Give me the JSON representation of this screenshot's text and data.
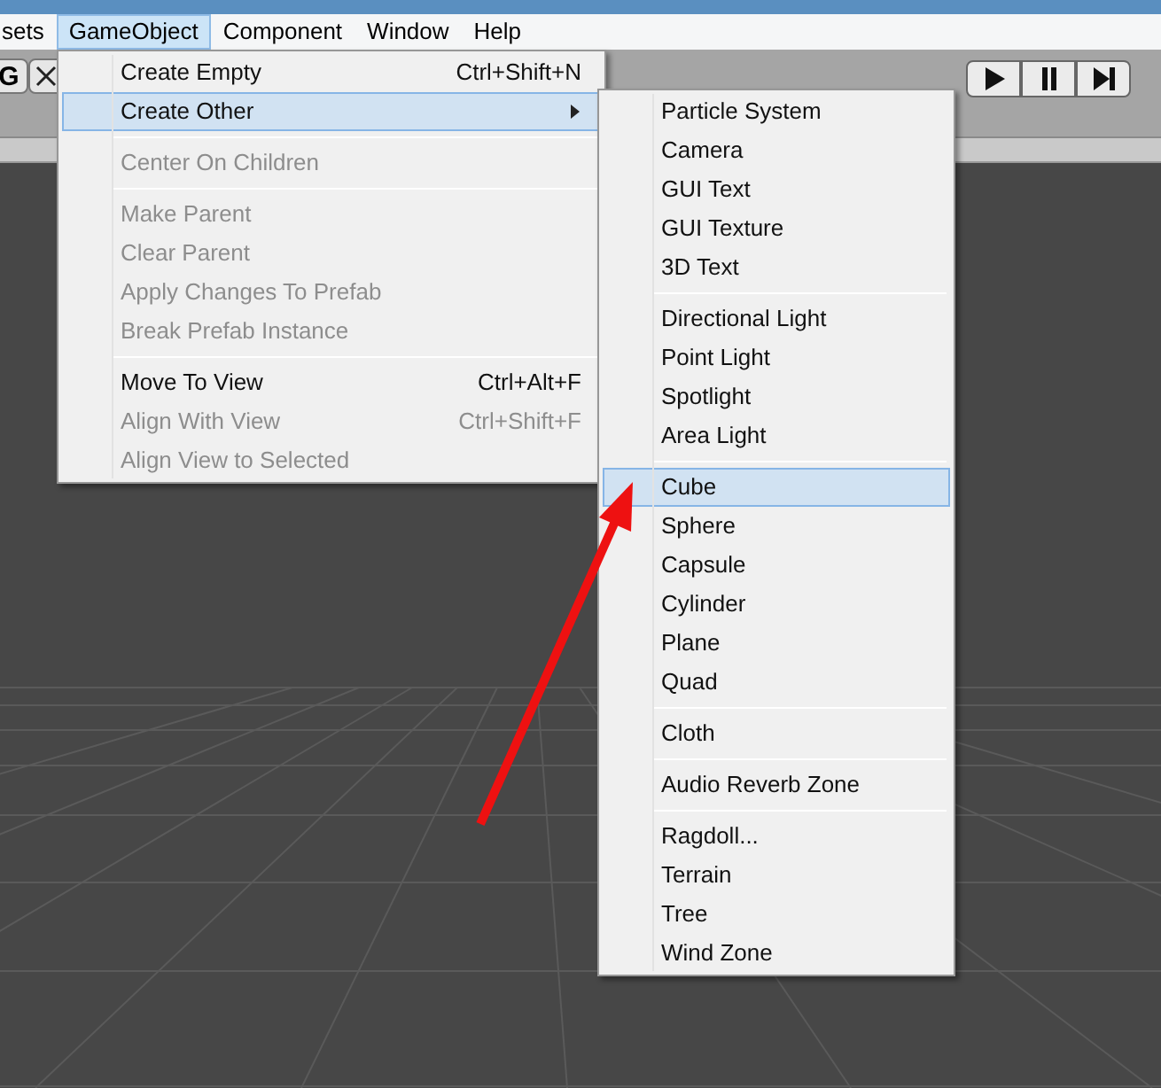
{
  "menu_bar": [
    {
      "label": "sets",
      "selected": false
    },
    {
      "label": "GameObject",
      "selected": true
    },
    {
      "label": "Component",
      "selected": false
    },
    {
      "label": "Window",
      "selected": false
    },
    {
      "label": "Help",
      "selected": false
    }
  ],
  "toolbar": {
    "tool_label": "G"
  },
  "menu": [
    {
      "kind": "item",
      "label": "Create Empty",
      "shortcut": "Ctrl+Shift+N",
      "disabled": false,
      "selected": false,
      "submenu": false
    },
    {
      "kind": "item",
      "label": "Create Other",
      "disabled": false,
      "selected": true,
      "submenu": true
    },
    {
      "kind": "separator"
    },
    {
      "kind": "item",
      "label": "Center On Children",
      "disabled": true,
      "selected": false,
      "submenu": false
    },
    {
      "kind": "separator"
    },
    {
      "kind": "item",
      "label": "Make Parent",
      "disabled": true,
      "selected": false,
      "submenu": false
    },
    {
      "kind": "item",
      "label": "Clear Parent",
      "disabled": true,
      "selected": false,
      "submenu": false
    },
    {
      "kind": "item",
      "label": "Apply Changes To Prefab",
      "disabled": true,
      "selected": false,
      "submenu": false
    },
    {
      "kind": "item",
      "label": "Break Prefab Instance",
      "disabled": true,
      "selected": false,
      "submenu": false
    },
    {
      "kind": "separator"
    },
    {
      "kind": "item",
      "label": "Move To View",
      "shortcut": "Ctrl+Alt+F",
      "disabled": false,
      "selected": false,
      "submenu": false
    },
    {
      "kind": "item",
      "label": "Align With View",
      "shortcut": "Ctrl+Shift+F",
      "disabled": true,
      "selected": false,
      "submenu": false
    },
    {
      "kind": "item",
      "label": "Align View to Selected",
      "disabled": true,
      "selected": false,
      "submenu": false
    }
  ],
  "submenu": [
    {
      "kind": "item",
      "label": "Particle System",
      "selected": false
    },
    {
      "kind": "item",
      "label": "Camera",
      "selected": false
    },
    {
      "kind": "item",
      "label": "GUI Text",
      "selected": false
    },
    {
      "kind": "item",
      "label": "GUI Texture",
      "selected": false
    },
    {
      "kind": "item",
      "label": "3D Text",
      "selected": false
    },
    {
      "kind": "separator"
    },
    {
      "kind": "item",
      "label": "Directional Light",
      "selected": false
    },
    {
      "kind": "item",
      "label": "Point Light",
      "selected": false
    },
    {
      "kind": "item",
      "label": "Spotlight",
      "selected": false
    },
    {
      "kind": "item",
      "label": "Area Light",
      "selected": false
    },
    {
      "kind": "separator"
    },
    {
      "kind": "item",
      "label": "Cube",
      "selected": true
    },
    {
      "kind": "item",
      "label": "Sphere",
      "selected": false
    },
    {
      "kind": "item",
      "label": "Capsule",
      "selected": false
    },
    {
      "kind": "item",
      "label": "Cylinder",
      "selected": false
    },
    {
      "kind": "item",
      "label": "Plane",
      "selected": false
    },
    {
      "kind": "item",
      "label": "Quad",
      "selected": false
    },
    {
      "kind": "separator"
    },
    {
      "kind": "item",
      "label": "Cloth",
      "selected": false
    },
    {
      "kind": "separator"
    },
    {
      "kind": "item",
      "label": "Audio Reverb Zone",
      "selected": false
    },
    {
      "kind": "separator"
    },
    {
      "kind": "item",
      "label": "Ragdoll...",
      "selected": false
    },
    {
      "kind": "item",
      "label": "Terrain",
      "selected": false
    },
    {
      "kind": "item",
      "label": "Tree",
      "selected": false
    },
    {
      "kind": "item",
      "label": "Wind Zone",
      "selected": false
    }
  ]
}
